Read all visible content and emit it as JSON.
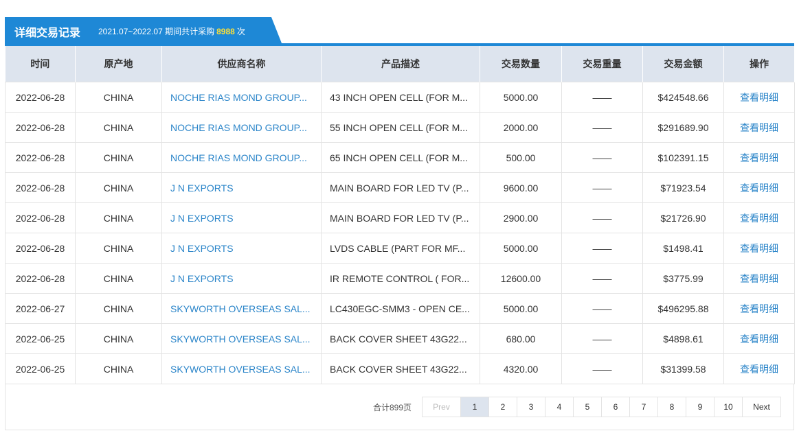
{
  "header": {
    "title": "详细交易记录",
    "period": "2021.07~2022.07 期间共计采购",
    "count": "8988",
    "unit": "次"
  },
  "table": {
    "columns": [
      "时间",
      "原产地",
      "供应商名称",
      "产品描述",
      "交易数量",
      "交易重量",
      "交易金额",
      "操作"
    ],
    "rows": [
      {
        "date": "2022-06-28",
        "origin": "CHINA",
        "supplier": "NOCHE RIAS MOND GROUP...",
        "desc": "43 INCH OPEN CELL (FOR M...",
        "qty": "5000.00",
        "weight": "——",
        "amount": "$424548.66",
        "op": "查看明细"
      },
      {
        "date": "2022-06-28",
        "origin": "CHINA",
        "supplier": "NOCHE RIAS MOND GROUP...",
        "desc": "55 INCH OPEN CELL (FOR M...",
        "qty": "2000.00",
        "weight": "——",
        "amount": "$291689.90",
        "op": "查看明细"
      },
      {
        "date": "2022-06-28",
        "origin": "CHINA",
        "supplier": "NOCHE RIAS MOND GROUP...",
        "desc": "65 INCH OPEN CELL (FOR M...",
        "qty": "500.00",
        "weight": "——",
        "amount": "$102391.15",
        "op": "查看明细"
      },
      {
        "date": "2022-06-28",
        "origin": "CHINA",
        "supplier": "J N EXPORTS",
        "desc": "MAIN BOARD FOR LED TV (P...",
        "qty": "9600.00",
        "weight": "——",
        "amount": "$71923.54",
        "op": "查看明细"
      },
      {
        "date": "2022-06-28",
        "origin": "CHINA",
        "supplier": "J N EXPORTS",
        "desc": "MAIN BOARD FOR LED TV (P...",
        "qty": "2900.00",
        "weight": "——",
        "amount": "$21726.90",
        "op": "查看明细"
      },
      {
        "date": "2022-06-28",
        "origin": "CHINA",
        "supplier": "J N EXPORTS",
        "desc": "LVDS CABLE (PART FOR MF...",
        "qty": "5000.00",
        "weight": "——",
        "amount": "$1498.41",
        "op": "查看明细"
      },
      {
        "date": "2022-06-28",
        "origin": "CHINA",
        "supplier": "J N EXPORTS",
        "desc": "IR REMOTE CONTROL ( FOR...",
        "qty": "12600.00",
        "weight": "——",
        "amount": "$3775.99",
        "op": "查看明细"
      },
      {
        "date": "2022-06-27",
        "origin": "CHINA",
        "supplier": "SKYWORTH OVERSEAS SAL...",
        "desc": "LC430EGC-SMM3 - OPEN CE...",
        "qty": "5000.00",
        "weight": "——",
        "amount": "$496295.88",
        "op": "查看明细"
      },
      {
        "date": "2022-06-25",
        "origin": "CHINA",
        "supplier": "SKYWORTH OVERSEAS SAL...",
        "desc": "BACK COVER SHEET 43G22...",
        "qty": "680.00",
        "weight": "——",
        "amount": "$4898.61",
        "op": "查看明细"
      },
      {
        "date": "2022-06-25",
        "origin": "CHINA",
        "supplier": "SKYWORTH OVERSEAS SAL...",
        "desc": "BACK COVER SHEET 43G22...",
        "qty": "4320.00",
        "weight": "——",
        "amount": "$31399.58",
        "op": "查看明细"
      }
    ]
  },
  "pagination": {
    "total": "合计899页",
    "prev": "Prev",
    "next": "Next",
    "pages": [
      "1",
      "2",
      "3",
      "4",
      "5",
      "6",
      "7",
      "8",
      "9",
      "10"
    ],
    "current": "1"
  }
}
